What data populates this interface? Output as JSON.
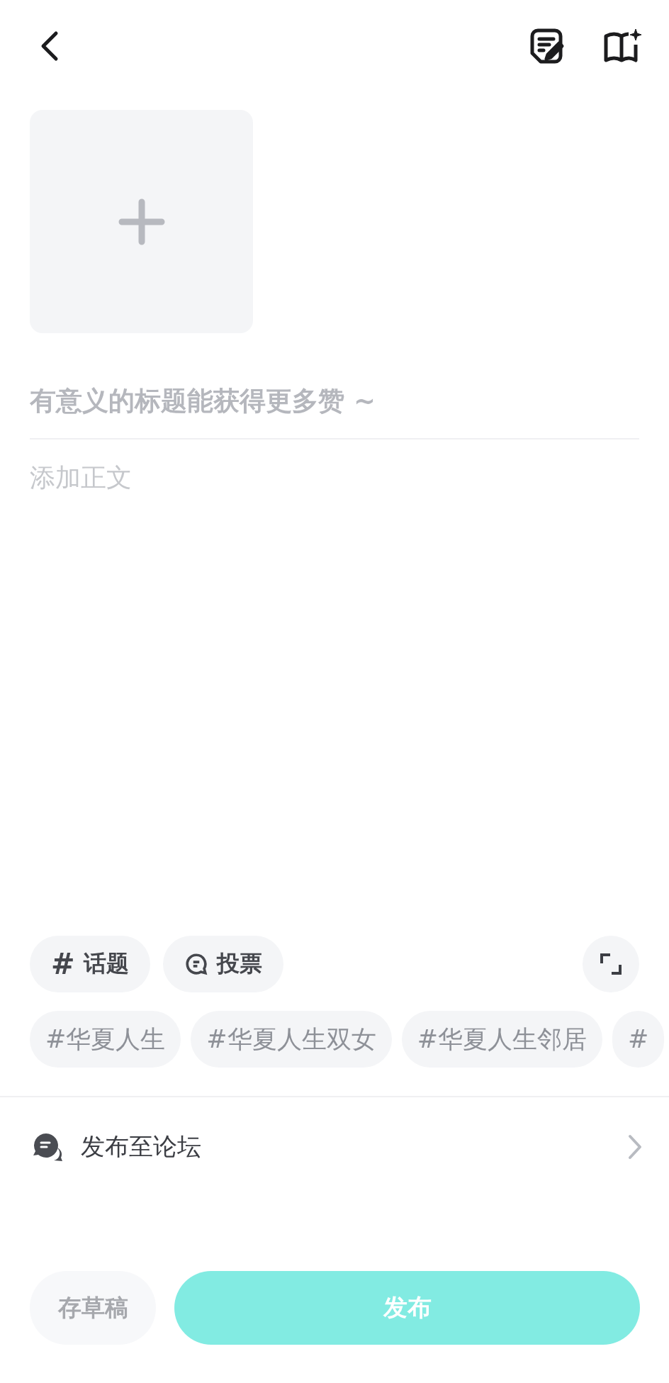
{
  "title_field": {
    "placeholder": "有意义的标题能获得更多赞 ~"
  },
  "body_field": {
    "placeholder": "添加正文"
  },
  "tools": [
    {
      "kind": "topic",
      "icon": "#",
      "label": "话题"
    },
    {
      "kind": "vote",
      "label": "投票"
    }
  ],
  "topic_tags": [
    "#华夏人生",
    "#华夏人生双女",
    "#华夏人生邻居",
    "#"
  ],
  "forum_row": {
    "label": "发布至论坛"
  },
  "buttons": {
    "draft": "存草稿",
    "publish": "发布"
  }
}
